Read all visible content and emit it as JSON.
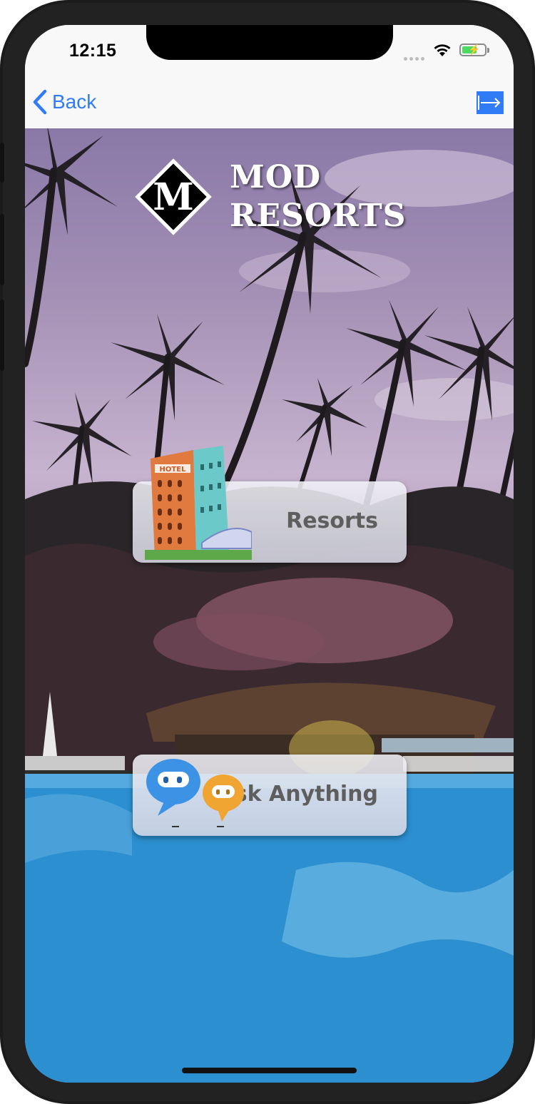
{
  "status_bar": {
    "time": "12:15"
  },
  "nav": {
    "back_label": "Back"
  },
  "logo": {
    "letter": "M",
    "line1": "MOD",
    "line2": "RESORTS"
  },
  "cards": [
    {
      "label": "Resorts",
      "icon": "hotel-icon"
    },
    {
      "label": "Ask Anything",
      "icon": "chatbot-icon"
    }
  ],
  "colors": {
    "accent": "#2f7cf6",
    "battery": "#4cd964"
  }
}
